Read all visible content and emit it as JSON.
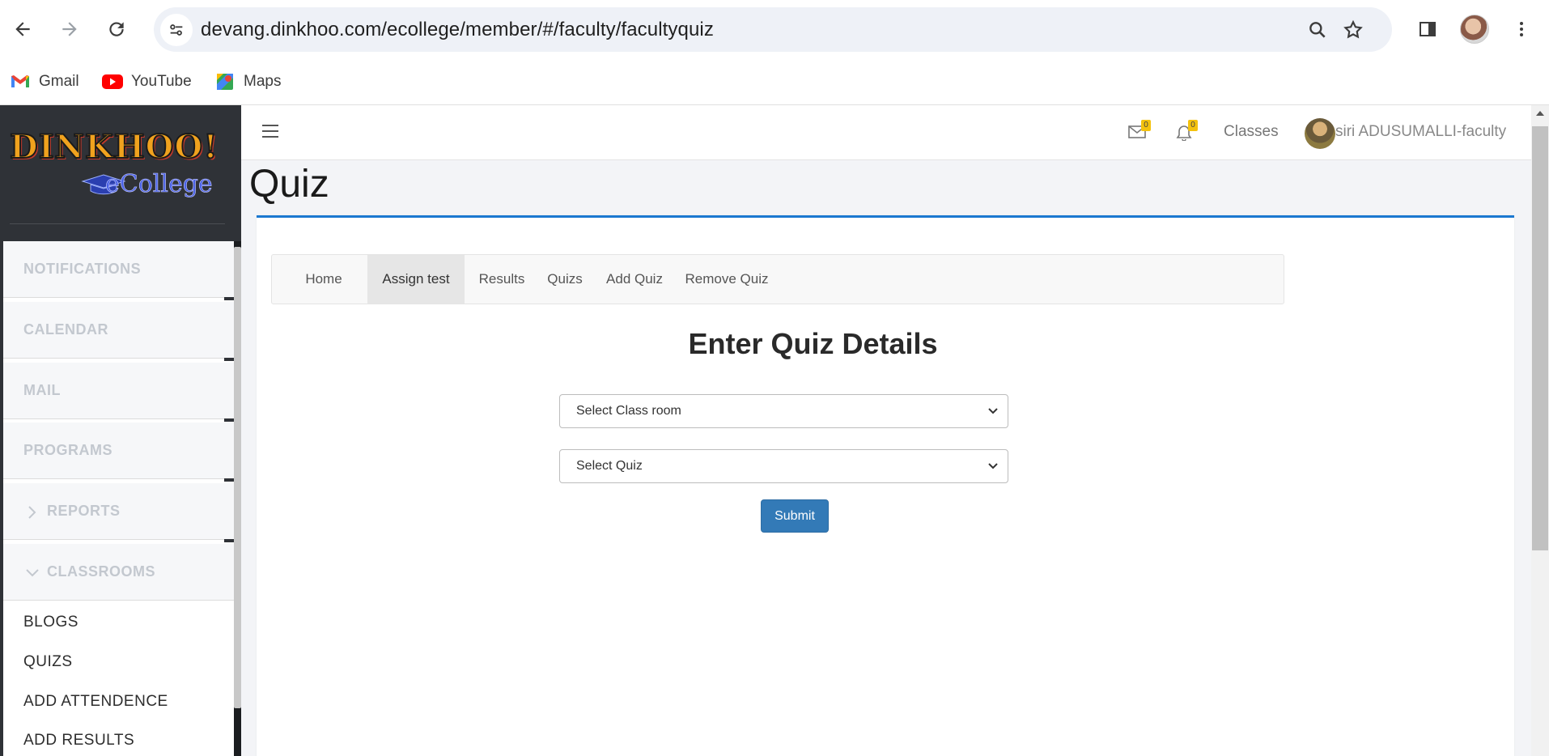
{
  "browser": {
    "url": "devang.dinkhoo.com/ecollege/member/#/faculty/facultyquiz",
    "bookmarks": [
      {
        "label": "Gmail",
        "icon": "gmail-icon"
      },
      {
        "label": "YouTube",
        "icon": "youtube-icon"
      },
      {
        "label": "Maps",
        "icon": "maps-icon"
      }
    ]
  },
  "logo": {
    "top": "DINKHOO!",
    "bottom": "eCollege"
  },
  "sidebar": {
    "groups": [
      {
        "label": "NOTIFICATIONS"
      },
      {
        "label": "CALENDAR"
      },
      {
        "label": "MAIL"
      },
      {
        "label": "PROGRAMS"
      },
      {
        "label": "REPORTS",
        "chevron": "chevron-right-icon"
      },
      {
        "label": "CLASSROOMS",
        "chevron": "chevron-down-icon"
      }
    ],
    "subitems": [
      {
        "label": "BLOGS"
      },
      {
        "label": "QUIZS"
      },
      {
        "label": "ADD ATTENDENCE"
      },
      {
        "label": "ADD RESULTS"
      }
    ]
  },
  "topbar": {
    "mail_count": "0",
    "notification_count": "0",
    "classes_label": "Classes",
    "user_name": "siri ADUSUMALLI-faculty"
  },
  "page": {
    "title": "Quiz"
  },
  "tabs": [
    {
      "label": "Home"
    },
    {
      "label": "Assign test",
      "active": true
    },
    {
      "label": "Results"
    },
    {
      "label": "Quizs"
    },
    {
      "label": "Add Quiz"
    },
    {
      "label": "Remove Quiz"
    }
  ],
  "form": {
    "heading": "Enter Quiz Details",
    "classroom_select": "Select Class room",
    "quiz_select": "Select Quiz",
    "submit_label": "Submit"
  },
  "colors": {
    "accent": "#1b78d0",
    "button": "#337ab7",
    "sidebar": "#2f3237",
    "badge": "#f4c20d"
  }
}
